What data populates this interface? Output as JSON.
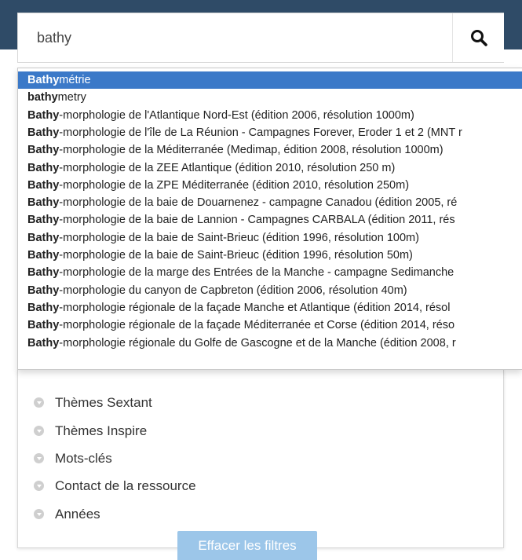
{
  "search": {
    "value": "bathy",
    "icon": "search-icon"
  },
  "suggestions": [
    {
      "match": "Bathy",
      "rest": "métrie",
      "selected": true
    },
    {
      "match": "bathy",
      "rest": "metry"
    },
    {
      "match": "Bathy",
      "rest": "-morphologie de l'Atlantique Nord-Est (édition 2006, résolution 1000m)"
    },
    {
      "match": "Bathy",
      "rest": "-morphologie de l'île de La Réunion - Campagnes Forever, Eroder 1 et 2 (MNT r"
    },
    {
      "match": "Bathy",
      "rest": "-morphologie de la Méditerranée (Medimap, édition 2008, résolution 1000m)"
    },
    {
      "match": "Bathy",
      "rest": "-morphologie de la ZEE Atlantique (édition 2010, résolution 250 m)"
    },
    {
      "match": "Bathy",
      "rest": "-morphologie de la ZPE Méditerranée (édition 2010, résolution 250m)"
    },
    {
      "match": "Bathy",
      "rest": "-morphologie de la baie de Douarnenez - campagne Canadou (édition 2005, ré"
    },
    {
      "match": "Bathy",
      "rest": "-morphologie de la baie de Lannion - Campagnes CARBALA (édition 2011, rés"
    },
    {
      "match": "Bathy",
      "rest": "-morphologie de la baie de Saint-Brieuc (édition 1996, résolution 100m)"
    },
    {
      "match": "Bathy",
      "rest": "-morphologie de la baie de Saint-Brieuc (édition 1996, résolution 50m)"
    },
    {
      "match": "Bathy",
      "rest": "-morphologie de la marge des Entrées de la Manche - campagne Sedimanche"
    },
    {
      "match": "Bathy",
      "rest": "-morphologie du canyon de Capbreton (édition 2006, résolution 40m)"
    },
    {
      "match": "Bathy",
      "rest": "-morphologie régionale de la façade Manche et Atlantique (édition 2014, résol"
    },
    {
      "match": "Bathy",
      "rest": "-morphologie régionale de la façade Méditerranée et Corse (édition 2014, réso"
    },
    {
      "match": "Bathy",
      "rest": "-morphologie régionale du Golfe de Gascogne et de la Manche (édition 2008, r"
    }
  ],
  "facets": [
    {
      "label": "Thèmes Sextant"
    },
    {
      "label": "Thèmes Inspire"
    },
    {
      "label": "Mots-clés"
    },
    {
      "label": "Contact de la ressource"
    },
    {
      "label": "Années"
    }
  ],
  "clear_button": "Effacer les filtres",
  "colors": {
    "header": "#2f4b67",
    "selected": "#3b79c8",
    "clear_button": "#9cc6e9"
  }
}
